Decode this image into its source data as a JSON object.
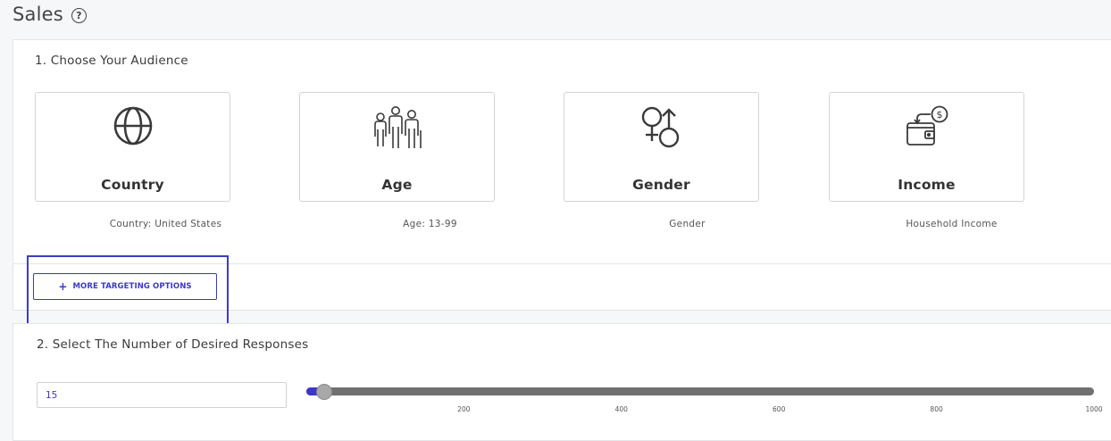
{
  "page": {
    "title": "Sales",
    "help_icon": "question-circle-icon",
    "help_glyph": "?"
  },
  "audience": {
    "heading": "1. Choose Your Audience",
    "cards": [
      {
        "label": "Country",
        "caption": "Country: United States",
        "icon": "globe-icon"
      },
      {
        "label": "Age",
        "caption": "Age: 13-99",
        "icon": "family-icon"
      },
      {
        "label": "Gender",
        "caption": "Gender",
        "icon": "gender-icon"
      },
      {
        "label": "Income",
        "caption": "Household Income",
        "icon": "wallet-dollar-icon"
      }
    ]
  },
  "more_targeting": {
    "label": "MORE TARGETING OPTIONS",
    "plus": "+"
  },
  "responses": {
    "heading": "2. Select The Number of Desired Responses",
    "value": "15",
    "slider": {
      "min": 0,
      "max": 1000,
      "value": 15,
      "ticks": [
        "200",
        "400",
        "600",
        "800",
        "1000"
      ]
    }
  },
  "colors": {
    "accent": "#3b37c8",
    "highlight_border": "#3b3fbf",
    "track": "#707070",
    "thumb": "#a8a8a8"
  }
}
